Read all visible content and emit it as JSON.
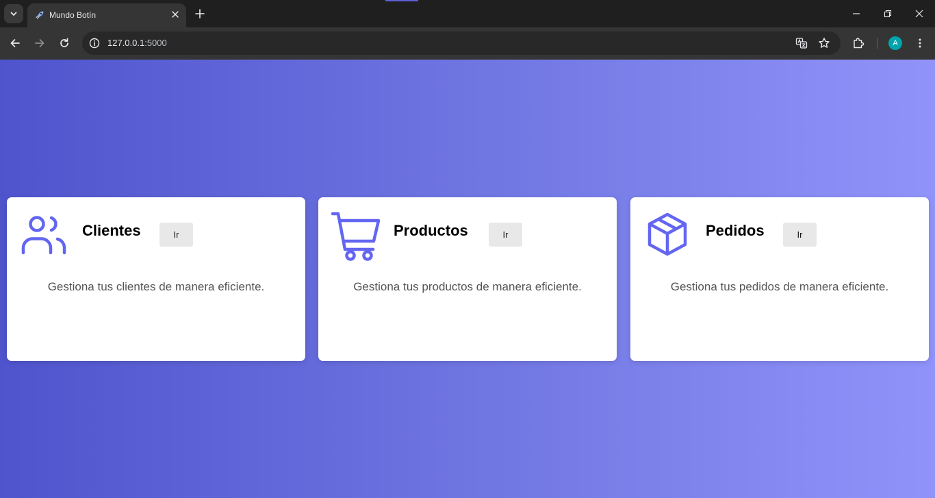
{
  "browser": {
    "tab_title": "Mundo Botín",
    "url_host": "127.0.0.1",
    "url_port": ":5000",
    "profile_initial": "A"
  },
  "icons": {
    "tab_search": "chevron-down-icon",
    "favicon": "rocket-icon",
    "tab_close": "close-icon",
    "new_tab": "plus-icon",
    "back": "arrow-left-icon",
    "forward": "arrow-right-icon",
    "reload": "reload-icon",
    "site_info": "info-icon",
    "translate": "translate-icon",
    "bookmark": "star-icon",
    "extensions": "puzzle-icon",
    "menu": "kebab-menu-icon"
  },
  "colors": {
    "accent": "#6366f1",
    "gradient_start": "#4f54cd",
    "gradient_end": "#9093f9",
    "avatar": "#00a4ad"
  },
  "cards": [
    {
      "icon": "users-icon",
      "title": "Clientes",
      "button": "Ir",
      "description": "Gestiona tus clientes de manera eficiente."
    },
    {
      "icon": "shopping-cart-icon",
      "title": "Productos",
      "button": "Ir",
      "description": "Gestiona tus productos de manera eficiente."
    },
    {
      "icon": "box-icon",
      "title": "Pedidos",
      "button": "Ir",
      "description": "Gestiona tus pedidos de manera eficiente."
    }
  ]
}
